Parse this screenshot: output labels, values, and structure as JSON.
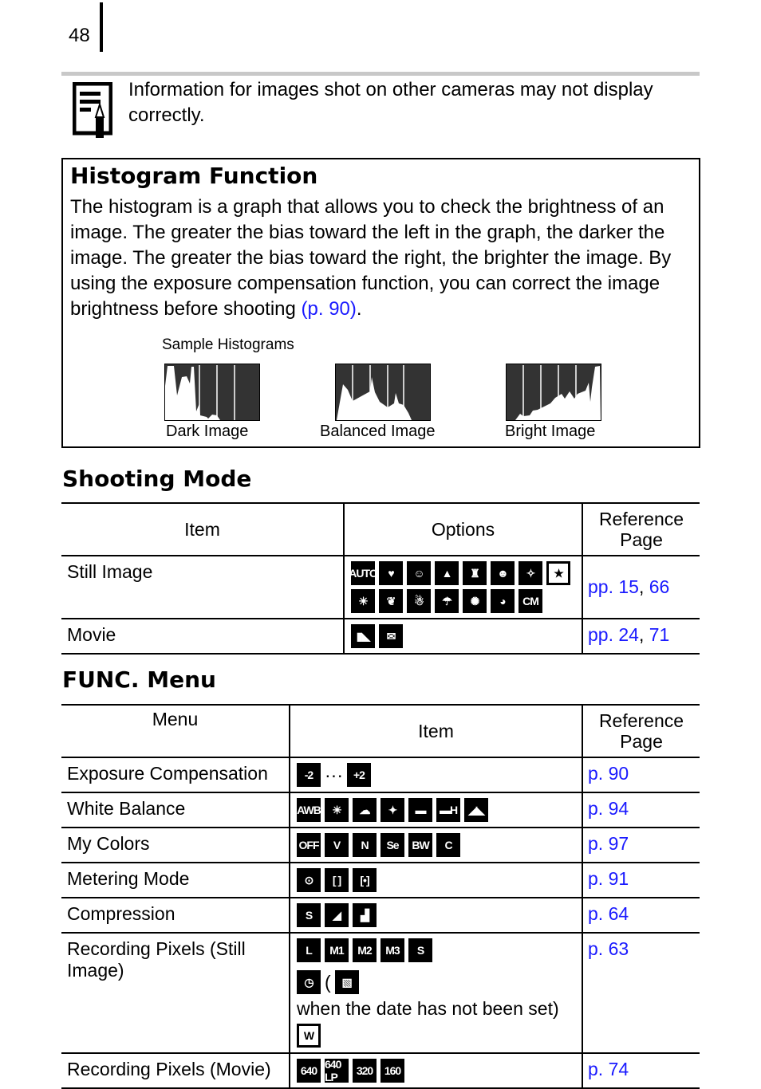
{
  "page_number": "48",
  "note": {
    "icon": "note-pencil-icon",
    "text": "Information for images shot on other cameras may not display correctly."
  },
  "histogram": {
    "title": "Histogram Function",
    "body_text": "The histogram is a graph that allows you to check the brightness of an image. The greater the bias toward the left in the graph, the darker the image. The greater the bias toward the right, the brighter the image. By using the exposure compensation function, you can correct the image brightness before shooting ",
    "link_text": "(p. 90)",
    "period": ".",
    "sample_label": "Sample Histograms",
    "samples": [
      {
        "caption": "Dark Image",
        "icon": "dark-histogram-icon"
      },
      {
        "caption": "Balanced Image",
        "icon": "balanced-histogram-icon"
      },
      {
        "caption": "Bright Image",
        "icon": "bright-histogram-icon"
      }
    ]
  },
  "shooting_mode": {
    "title": "Shooting Mode",
    "headers": {
      "item": "Item",
      "options": "Options",
      "ref": "Reference Page"
    },
    "rows": [
      {
        "item": "Still Image",
        "icons": [
          "AUTO",
          "camera-heart",
          "portrait",
          "landscape",
          "night-snapshot",
          "kids-pets",
          "indoor-party",
          "special-scene-star",
          "sunset",
          "foliage",
          "snow",
          "beach",
          "fireworks",
          "underwater",
          "color-swap-CM"
        ],
        "ref_prefix": "pp. ",
        "ref_a": "15",
        "ref_sep": ", ",
        "ref_b": "66"
      },
      {
        "item": "Movie",
        "icons": [
          "movie-camera",
          "movie-email"
        ],
        "ref_prefix": "pp. ",
        "ref_a": "24",
        "ref_sep": ", ",
        "ref_b": "71"
      }
    ]
  },
  "func_menu": {
    "title": "FUNC. Menu",
    "headers": {
      "menu": "Menu",
      "item": "Item",
      "ref": "Reference Page"
    },
    "rows": [
      {
        "menu": "Exposure Compensation",
        "icons": [
          "-2",
          "…",
          "+2"
        ],
        "ref": "p. 90"
      },
      {
        "menu": "White Balance",
        "icons": [
          "AWB",
          "daylight",
          "cloudy",
          "tungsten",
          "fluorescent",
          "fluorescent-H",
          "custom"
        ],
        "ref": "p. 94"
      },
      {
        "menu": "My Colors",
        "icons": [
          "OFF",
          "V",
          "N",
          "Se",
          "BW",
          "C"
        ],
        "ref": "p. 97"
      },
      {
        "menu": "Metering Mode",
        "icons": [
          "evaluative",
          "center-weighted",
          "spot"
        ],
        "ref": "p. 91"
      },
      {
        "menu": "Compression",
        "icons": [
          "superfine-S",
          "fine",
          "normal"
        ],
        "ref": "p. 64"
      },
      {
        "menu": "Recording Pixels (Still Image)",
        "icons": [
          "L",
          "M1",
          "M2",
          "M3",
          "S"
        ],
        "extra_text_1": " (",
        "extra_text_2": " when the date has not been set) ",
        "extra_icons": [
          "date-stamp",
          "postcard",
          "W"
        ],
        "ref": "p. 63"
      },
      {
        "menu": "Recording Pixels (Movie)",
        "icons": [
          "640",
          "640 LP",
          "320",
          "160"
        ],
        "ref": "p. 74"
      }
    ]
  }
}
